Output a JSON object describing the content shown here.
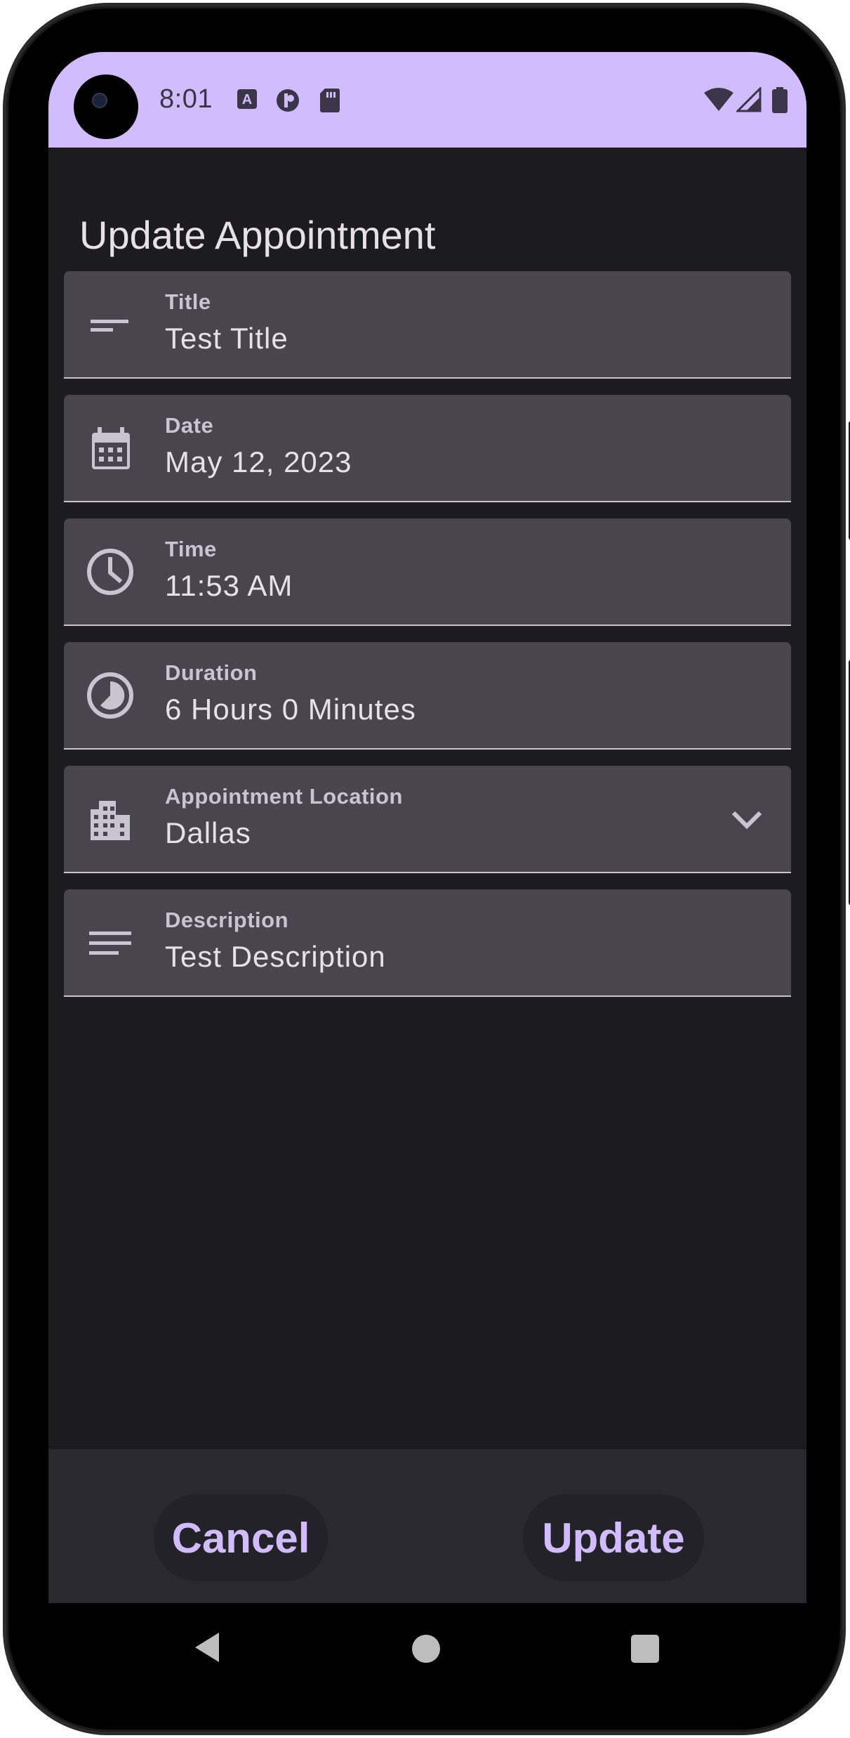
{
  "status_bar": {
    "time": "8:01",
    "icons": [
      "autofill-icon",
      "assistant-icon",
      "sd-card-icon",
      "wifi-icon",
      "signal-icon",
      "battery-icon"
    ],
    "background": "#d0bcfe"
  },
  "page": {
    "title": "Update Appointment"
  },
  "fields": [
    {
      "icon": "short-text-icon",
      "label": "Title",
      "value": "Test Title"
    },
    {
      "icon": "calendar-icon",
      "label": "Date",
      "value": "May 12, 2023"
    },
    {
      "icon": "clock-icon",
      "label": "Time",
      "value": "11:53 AM"
    },
    {
      "icon": "timelapse-icon",
      "label": "Duration",
      "value": "6 Hours 0 Minutes"
    },
    {
      "icon": "building-icon",
      "label": "Appointment Location",
      "value": "Dallas",
      "dropdown": true
    },
    {
      "icon": "notes-icon",
      "label": "Description",
      "value": "Test Description"
    }
  ],
  "actions": {
    "cancel_label": "Cancel",
    "update_label": "Update"
  },
  "nav_bar": {
    "icons": [
      "back-icon",
      "home-icon",
      "recents-icon"
    ]
  },
  "colors": {
    "accent": "#d0bcfe",
    "surface": "#1c1b20",
    "field_bg": "#49454f",
    "text": "#e6e0e9",
    "label": "#cac4d0"
  }
}
